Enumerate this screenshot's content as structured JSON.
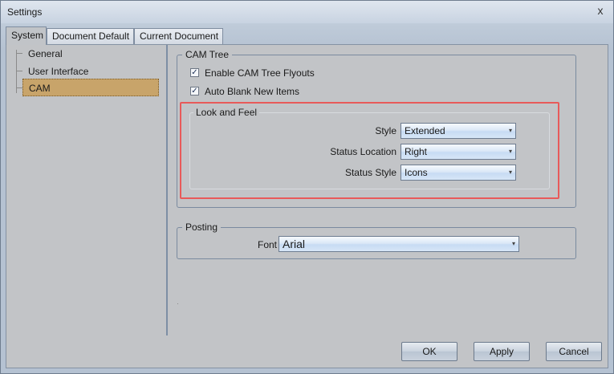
{
  "window": {
    "title": "Settings",
    "close_glyph": "x"
  },
  "tabs": [
    {
      "label": "System",
      "active": true
    },
    {
      "label": "Document Default",
      "active": false
    },
    {
      "label": "Current Document",
      "active": false
    }
  ],
  "tree": {
    "items": [
      {
        "label": "General",
        "selected": false
      },
      {
        "label": "User Interface",
        "selected": false
      },
      {
        "label": "CAM",
        "selected": true
      }
    ]
  },
  "cam_tree": {
    "legend": "CAM Tree",
    "checkboxes": [
      {
        "label": "Enable CAM Tree Flyouts",
        "checked": true
      },
      {
        "label": "Auto Blank New Items",
        "checked": true
      }
    ],
    "look_and_feel": {
      "legend": "Look and Feel",
      "fields": [
        {
          "label": "Style",
          "value": "Extended"
        },
        {
          "label": "Status Location",
          "value": "Right"
        },
        {
          "label": "Status Style",
          "value": "Icons"
        }
      ]
    }
  },
  "posting": {
    "legend": "Posting",
    "font_label": "Font",
    "font_value": "Arial"
  },
  "buttons": {
    "ok": "OK",
    "apply": "Apply",
    "cancel": "Cancel"
  },
  "colors": {
    "selection": "#c8a46a",
    "highlight_border": "#e85a5a"
  },
  "icons": {
    "checkbox_mark": "✓",
    "dropdown_arrow": "▾"
  }
}
